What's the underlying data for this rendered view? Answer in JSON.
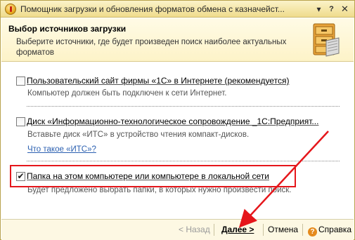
{
  "window": {
    "title": "Помощник загрузки и обновления форматов обмена с казначейст...",
    "controls": {
      "menu": "▾",
      "help": "?",
      "close": "✕"
    }
  },
  "header": {
    "title": "Выбор источников загрузки",
    "description": "Выберите источники, где будет произведен поиск наиболее актуальных форматов"
  },
  "options": [
    {
      "label": "Пользовательский сайт фирмы «1С» в Интернете (рекомендуется)",
      "description": "Компьютер должен быть подключен к сети Интернет.",
      "checked": false
    },
    {
      "label": "Диск «Информационно-технологическое сопровождение _1С:Предприят...",
      "description": "Вставьте диск «ИТС» в устройство чтения компакт-дисков.",
      "link": "Что такое «ИТС»?",
      "checked": false
    },
    {
      "label": "Папка на этом компьютере или компьютере в локальной сети",
      "description": "Будет предложено выбрать папки, в которых нужно произвести поиск.",
      "checked": true
    }
  ],
  "footer": {
    "back": "< Назад",
    "next": "Далее >",
    "cancel": "Отмена",
    "help": "Справка",
    "help_icon": "?"
  },
  "annotation": {
    "highlight_color": "#e5161b"
  }
}
